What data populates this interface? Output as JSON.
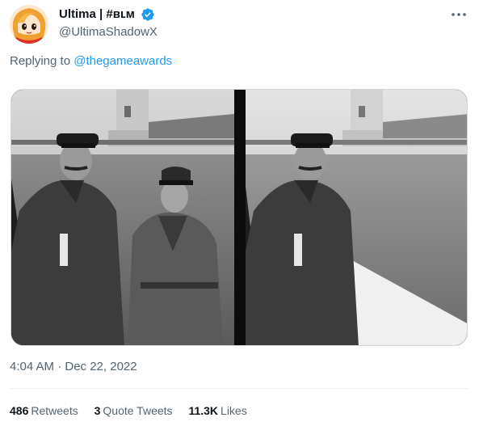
{
  "author": {
    "display_name": "Ultima | #ʙʟᴍ",
    "handle": "@UltimaShadowX",
    "verified": true,
    "avatar_icon": "anime-avatar-icon"
  },
  "reply": {
    "prefix": "Replying to",
    "target": "@thegameawards"
  },
  "media": {
    "panels": 2
  },
  "timestamp": "4:04 AM · Dec 22, 2022",
  "stats": [
    {
      "count": "486",
      "label": "Retweets"
    },
    {
      "count": "3",
      "label": "Quote Tweets"
    },
    {
      "count": "11.3K",
      "label": "Likes"
    }
  ],
  "colors": {
    "accent": "#1d9bf0",
    "secondary_text": "#536471",
    "primary_text": "#0f1419"
  }
}
